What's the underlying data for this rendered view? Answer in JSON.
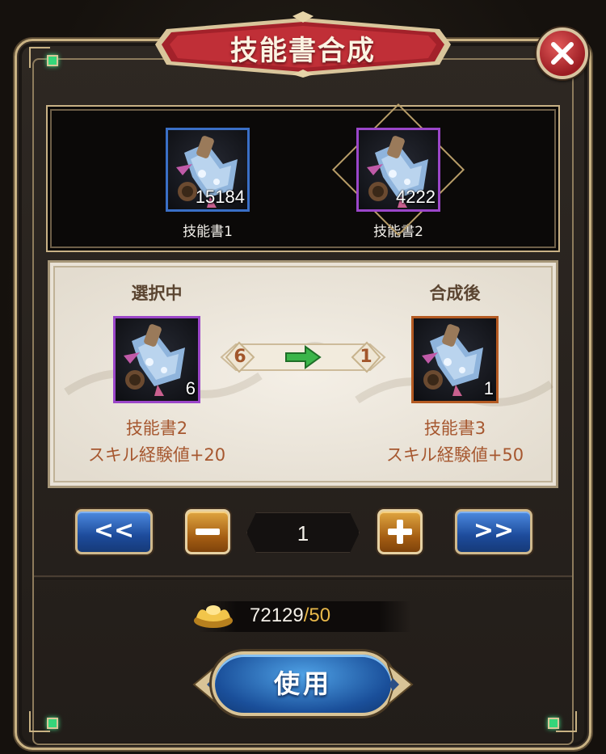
{
  "dialog": {
    "title": "技能書合成"
  },
  "owned_items": [
    {
      "label": "技能書1",
      "count": "15184",
      "frame": "blue"
    },
    {
      "label": "技能書2",
      "count": "4222",
      "frame": "purple",
      "selected": true
    }
  ],
  "synthesis": {
    "source": {
      "heading": "選択中",
      "count": "6",
      "name": "技能書2",
      "effect": "スキル経験値+20",
      "frame": "purple"
    },
    "result": {
      "heading": "合成後",
      "count": "1",
      "name": "技能書3",
      "effect": "スキル経験値+50",
      "frame": "orange"
    },
    "ratio_in": "6",
    "ratio_out": "1"
  },
  "quantity": {
    "value": "1",
    "prev_label": "<<",
    "next_label": ">>"
  },
  "cost": {
    "owned": "72129",
    "separator": "/",
    "required": "50",
    "icon": "gold-ingot-icon"
  },
  "use_button": {
    "label": "使用"
  },
  "colors": {
    "banner_red": "#b3232b",
    "frame_gold": "#c9b283",
    "text_brown": "#a6572f",
    "nav_blue": "#1d4b9b",
    "step_orange": "#a35c12",
    "cost_required": "#e8b84a"
  }
}
